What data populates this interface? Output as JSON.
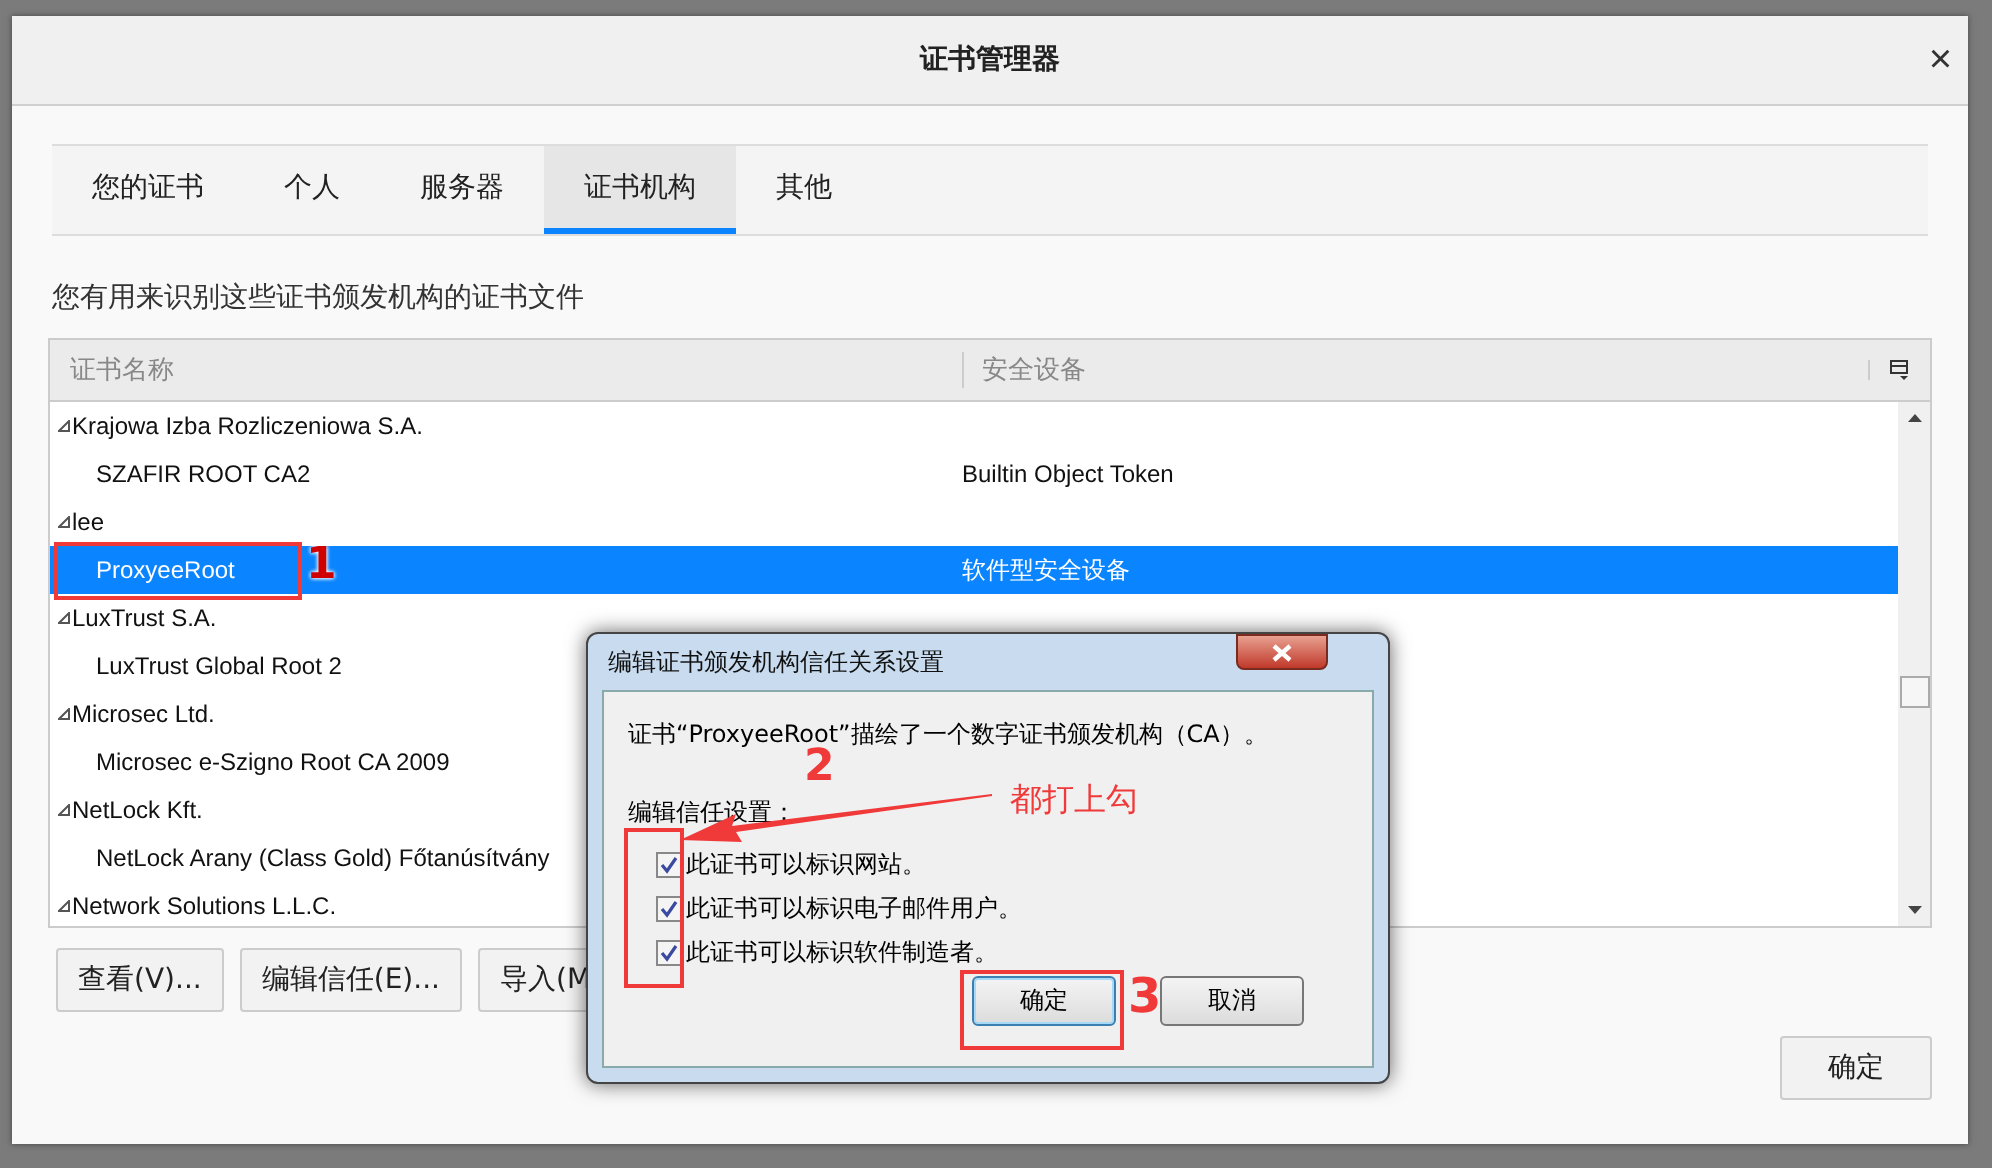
{
  "window": {
    "title": "证书管理器",
    "close": "×"
  },
  "tabs": [
    {
      "label": "您的证书",
      "selected": false
    },
    {
      "label": "个人",
      "selected": false
    },
    {
      "label": "服务器",
      "selected": false
    },
    {
      "label": "证书机构",
      "selected": true
    },
    {
      "label": "其他",
      "selected": false
    }
  ],
  "description": "您有用来识别这些证书颁发机构的证书文件",
  "table": {
    "columns": [
      "证书名称",
      "安全设备"
    ],
    "rows": [
      {
        "kind": "group",
        "name": "Krajowa Izba Rozliczeniowa S.A.",
        "selected": false
      },
      {
        "kind": "cert",
        "name": "SZAFIR ROOT CA2",
        "device": "Builtin Object Token",
        "selected": false
      },
      {
        "kind": "group",
        "name": "lee",
        "selected": false
      },
      {
        "kind": "cert",
        "name": "ProxyeeRoot",
        "device": "软件型安全设备",
        "selected": true
      },
      {
        "kind": "group",
        "name": "LuxTrust S.A.",
        "selected": false
      },
      {
        "kind": "cert",
        "name": "LuxTrust Global Root 2",
        "device": "",
        "selected": false
      },
      {
        "kind": "group",
        "name": "Microsec Ltd.",
        "selected": false
      },
      {
        "kind": "cert",
        "name": "Microsec e-Szigno Root CA 2009",
        "device": "",
        "selected": false
      },
      {
        "kind": "group",
        "name": "NetLock Kft.",
        "selected": false
      },
      {
        "kind": "cert",
        "name": "NetLock Arany (Class Gold) Főtanúsítvány",
        "device": "",
        "selected": false
      },
      {
        "kind": "group",
        "name": "Network Solutions L.L.C.",
        "selected": false
      }
    ]
  },
  "buttons": [
    "查看(V)...",
    "编辑信任(E)...",
    "导入(M"
  ],
  "ok_button": "确定",
  "dialog": {
    "title": "编辑证书颁发机构信任关系设置",
    "message": "证书“ProxyeeRoot”描绘了一个数字证书颁发机构（CA）。",
    "trust_label": "编辑信任设置：",
    "checkboxes": [
      {
        "label": "此证书可以标识网站。",
        "checked": true
      },
      {
        "label": "此证书可以标识电子邮件用户。",
        "checked": true
      },
      {
        "label": "此证书可以标识软件制造者。",
        "checked": true
      }
    ],
    "ok": "确定",
    "cancel": "取消"
  },
  "annotations": {
    "step1": "1",
    "step2": "2",
    "step3": "3",
    "note": "都打上勾"
  }
}
